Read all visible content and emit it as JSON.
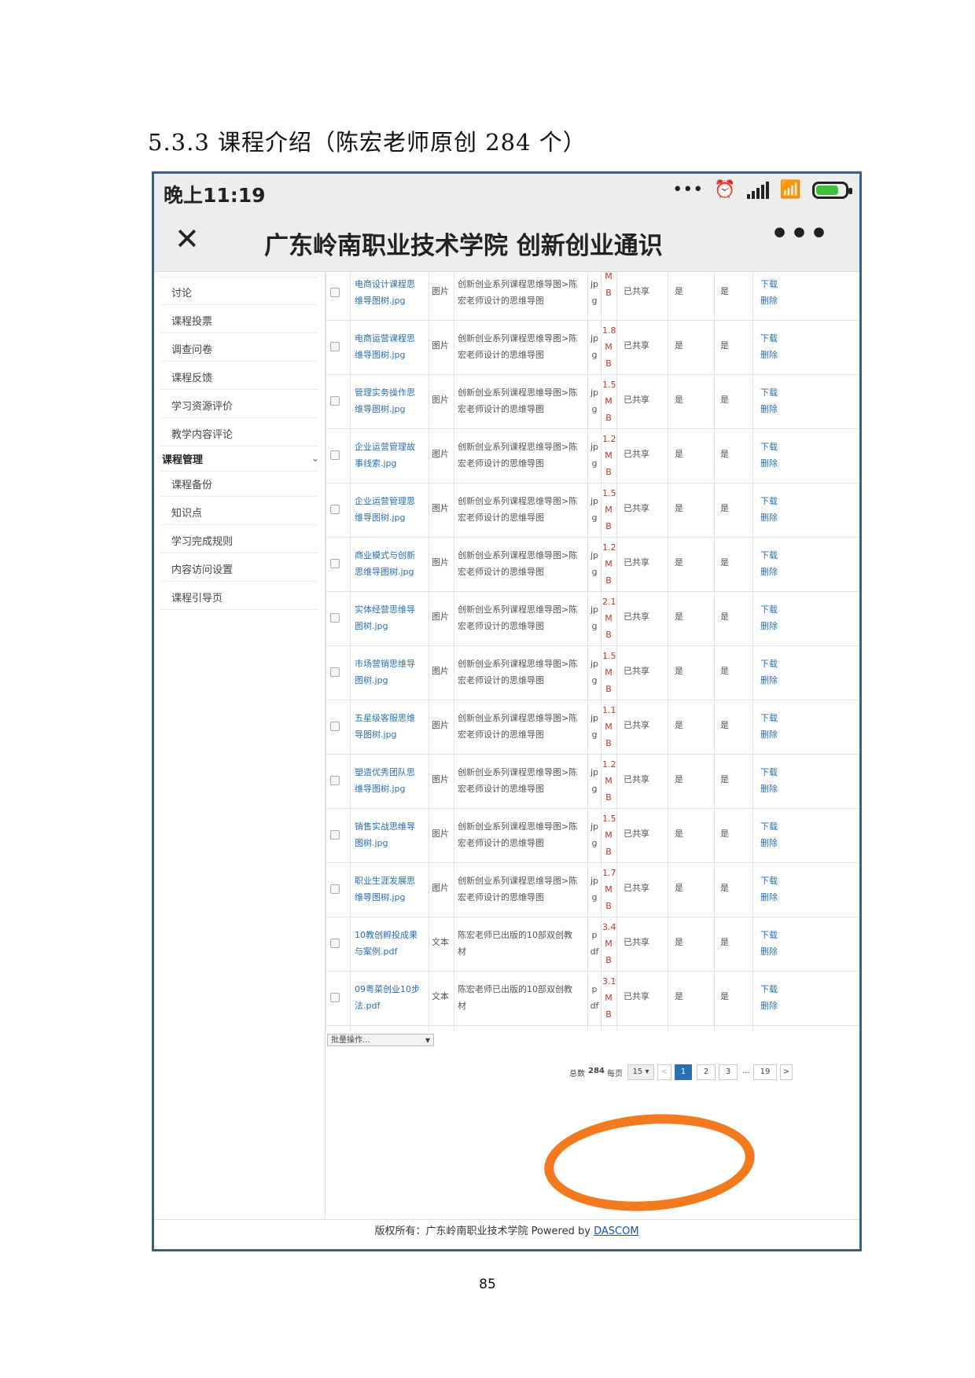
{
  "heading": "5.3.3 课程介绍（陈宏老师原创 284 个）",
  "page_number": "85",
  "status_bar": {
    "time": "晚上11:19"
  },
  "title_bar": {
    "close_icon": "close-icon",
    "title": "广东岭南职业技术学院 创新创业通识",
    "more_icon": "more-icon"
  },
  "sidebar": {
    "items_top": [
      "讨论",
      "课程投票",
      "调查问卷",
      "课程反馈",
      "学习资源评价",
      "教学内容评论"
    ],
    "group": "课程管理",
    "items_bottom": [
      "课程备份",
      "知识点",
      "学习完成规则",
      "内容访问设置",
      "课程引导页"
    ]
  },
  "table": {
    "rows": [
      {
        "name": [
          "电商设计课程思",
          "维导图树.jpg"
        ],
        "type": "图片",
        "desc": [
          "创新创业系列课程思维导图>陈",
          "宏老师设计的思维导图"
        ],
        "ext": [
          "jp",
          "g"
        ],
        "size": [
          "",
          "M",
          "B"
        ],
        "share": "已共享",
        "y1": "是",
        "y2": "是",
        "download": "下载",
        "delete": "删除"
      },
      {
        "name": [
          "电商运营课程思",
          "维导图树.jpg"
        ],
        "type": "图片",
        "desc": [
          "创新创业系列课程思维导图>陈",
          "宏老师设计的思维导图"
        ],
        "ext": [
          "jp",
          "g"
        ],
        "size": [
          "1.8",
          "M",
          "B"
        ],
        "share": "已共享",
        "y1": "是",
        "y2": "是",
        "download": "下载",
        "delete": "删除"
      },
      {
        "name": [
          "管理实务操作思",
          "维导图树.jpg"
        ],
        "type": "图片",
        "desc": [
          "创新创业系列课程思维导图>陈",
          "宏老师设计的思维导图"
        ],
        "ext": [
          "jp",
          "g"
        ],
        "size": [
          "1.5",
          "M",
          "B"
        ],
        "share": "已共享",
        "y1": "是",
        "y2": "是",
        "download": "下载",
        "delete": "删除"
      },
      {
        "name": [
          "企业运营管理故",
          "事线索.jpg"
        ],
        "type": "图片",
        "desc": [
          "创新创业系列课程思维导图>陈",
          "宏老师设计的思维导图"
        ],
        "ext": [
          "jp",
          "g"
        ],
        "size": [
          "1.2",
          "M",
          "B"
        ],
        "share": "已共享",
        "y1": "是",
        "y2": "是",
        "download": "下载",
        "delete": "删除"
      },
      {
        "name": [
          "企业运营管理思",
          "维导图树.jpg"
        ],
        "type": "图片",
        "desc": [
          "创新创业系列课程思维导图>陈",
          "宏老师设计的思维导图"
        ],
        "ext": [
          "jp",
          "g"
        ],
        "size": [
          "1.5",
          "M",
          "B"
        ],
        "share": "已共享",
        "y1": "是",
        "y2": "是",
        "download": "下载",
        "delete": "删除"
      },
      {
        "name": [
          "商业模式与创新",
          "思维导图树.jpg"
        ],
        "type": "图片",
        "desc": [
          "创新创业系列课程思维导图>陈",
          "宏老师设计的思维导图"
        ],
        "ext": [
          "jp",
          "g"
        ],
        "size": [
          "1.2",
          "M",
          "B"
        ],
        "share": "已共享",
        "y1": "是",
        "y2": "是",
        "download": "下载",
        "delete": "删除"
      },
      {
        "name": [
          "实体经营思维导",
          "图树.jpg"
        ],
        "type": "图片",
        "desc": [
          "创新创业系列课程思维导图>陈",
          "宏老师设计的思维导图"
        ],
        "ext": [
          "jp",
          "g"
        ],
        "size": [
          "2.1",
          "M",
          "B"
        ],
        "share": "已共享",
        "y1": "是",
        "y2": "是",
        "download": "下载",
        "delete": "删除"
      },
      {
        "name": [
          "市场营销思维导",
          "图树.jpg"
        ],
        "type": "图片",
        "desc": [
          "创新创业系列课程思维导图>陈",
          "宏老师设计的思维导图"
        ],
        "ext": [
          "jp",
          "g"
        ],
        "size": [
          "1.5",
          "M",
          "B"
        ],
        "share": "已共享",
        "y1": "是",
        "y2": "是",
        "download": "下载",
        "delete": "删除"
      },
      {
        "name": [
          "五星级客服思维",
          "导图树.jpg"
        ],
        "type": "图片",
        "desc": [
          "创新创业系列课程思维导图>陈",
          "宏老师设计的思维导图"
        ],
        "ext": [
          "jp",
          "g"
        ],
        "size": [
          "1.1",
          "M",
          "B"
        ],
        "share": "已共享",
        "y1": "是",
        "y2": "是",
        "download": "下载",
        "delete": "删除"
      },
      {
        "name": [
          "塑造优秀团队思",
          "维导图树.jpg"
        ],
        "type": "图片",
        "desc": [
          "创新创业系列课程思维导图>陈",
          "宏老师设计的思维导图"
        ],
        "ext": [
          "jp",
          "g"
        ],
        "size": [
          "1.2",
          "M",
          "B"
        ],
        "share": "已共享",
        "y1": "是",
        "y2": "是",
        "download": "下载",
        "delete": "删除"
      },
      {
        "name": [
          "销售实战思维导",
          "图树.jpg"
        ],
        "type": "图片",
        "desc": [
          "创新创业系列课程思维导图>陈",
          "宏老师设计的思维导图"
        ],
        "ext": [
          "jp",
          "g"
        ],
        "size": [
          "1.5",
          "M",
          "B"
        ],
        "share": "已共享",
        "y1": "是",
        "y2": "是",
        "download": "下载",
        "delete": "删除"
      },
      {
        "name": [
          "职业生涯发展思",
          "维导图树.jpg"
        ],
        "type": "图片",
        "desc": [
          "创新创业系列课程思维导图>陈",
          "宏老师设计的思维导图"
        ],
        "ext": [
          "jp",
          "g"
        ],
        "size": [
          "1.7",
          "M",
          "B"
        ],
        "share": "已共享",
        "y1": "是",
        "y2": "是",
        "download": "下载",
        "delete": "删除"
      },
      {
        "name": [
          "10教创孵投成果",
          "与案例.pdf"
        ],
        "type": "文本",
        "desc": [
          "陈宏老师已出版的10部双创教",
          "材"
        ],
        "ext": [
          "p",
          "df"
        ],
        "size": [
          "3.4",
          "M",
          "B"
        ],
        "share": "已共享",
        "y1": "是",
        "y2": "是",
        "download": "下载",
        "delete": "删除"
      },
      {
        "name": [
          "09粤菜创业10步",
          "法.pdf"
        ],
        "type": "文本",
        "desc": [
          "陈宏老师已出版的10部双创教",
          "材"
        ],
        "ext": [
          "p",
          "df"
        ],
        "size": [
          "3.1",
          "M",
          "B"
        ],
        "share": "已共享",
        "y1": "是",
        "y2": "是",
        "download": "下载",
        "delete": "删除"
      }
    ]
  },
  "batch_select": "批量操作...",
  "pagination": {
    "total_label": "总数",
    "total": "284",
    "per_page_label": "每页",
    "per_page": "15",
    "prev": "<",
    "current": "1",
    "pages": [
      "2",
      "3",
      "...",
      "19"
    ],
    "next": ">"
  },
  "footer": {
    "text": "版权所有：广东岭南职业技术学院 Powered by ",
    "link": "DASCOM"
  },
  "colors": {
    "annotation_circle": "#f47a20",
    "link": "#2a6fb0",
    "size_text": "#c0392b",
    "frame": "#3b5e8c"
  }
}
